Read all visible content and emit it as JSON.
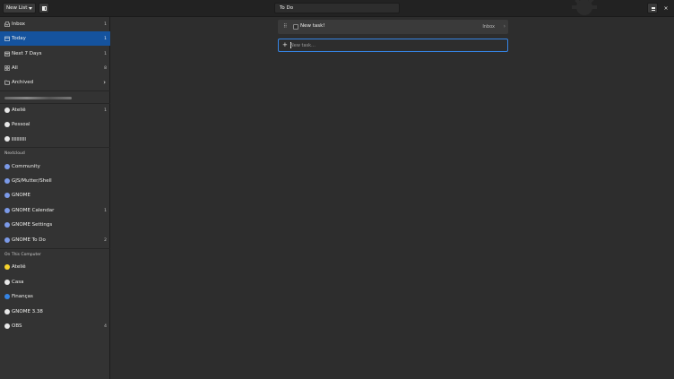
{
  "header": {
    "new_list_label": "New List",
    "title": "To Do",
    "close_glyph": "×"
  },
  "sidebar": {
    "smart_lists": [
      {
        "label": "Inbox",
        "count": "1",
        "icon": "inbox-icon"
      },
      {
        "label": "Today",
        "count": "1",
        "icon": "calendar-icon",
        "selected": true
      },
      {
        "label": "Next 7 Days",
        "count": "1",
        "icon": "calendar-week-icon"
      },
      {
        "label": "All",
        "count": "8",
        "icon": "grid-icon"
      },
      {
        "label": "Archived",
        "count": "",
        "icon": "folder-icon"
      }
    ],
    "personal_lists": [
      {
        "label": "Ateliê",
        "count": "1",
        "color": "#e8e8e8"
      },
      {
        "label": "Pessoal",
        "count": "",
        "color": "#e8e8e8"
      },
      {
        "label": "",
        "count": "",
        "color": "#e8e8e8"
      }
    ],
    "sections": {
      "nextcloud": "Nextcloud",
      "local": "On This Computer"
    },
    "nextcloud_lists": [
      {
        "label": "Community",
        "count": "",
        "color": "#7b9ae8"
      },
      {
        "label": "GJS/Mutter/Shell",
        "count": "",
        "color": "#7b9ae8"
      },
      {
        "label": "GNOME",
        "count": "",
        "color": "#7b9ae8"
      },
      {
        "label": "GNOME Calendar",
        "count": "1",
        "color": "#7b9ae8"
      },
      {
        "label": "GNOME Settings",
        "count": "",
        "color": "#7b9ae8"
      },
      {
        "label": "GNOME To Do",
        "count": "2",
        "color": "#7b9ae8"
      }
    ],
    "local_lists": [
      {
        "label": "Ateliê",
        "count": "",
        "color": "#f6d32d"
      },
      {
        "label": "Casa",
        "count": "",
        "color": "#e8e8e8"
      },
      {
        "label": "Finanças",
        "count": "",
        "color": "#3584e4"
      },
      {
        "label": "GNOME 3.38",
        "count": "",
        "color": "#e8e8e8"
      },
      {
        "label": "OBS",
        "count": "4",
        "color": "#e8e8e8"
      }
    ]
  },
  "main": {
    "task": {
      "title": "New task!",
      "list": "Inbox",
      "handle": "⠿",
      "arrow": "›"
    },
    "new_task": {
      "plus": "+",
      "placeholder": "New task…"
    }
  }
}
